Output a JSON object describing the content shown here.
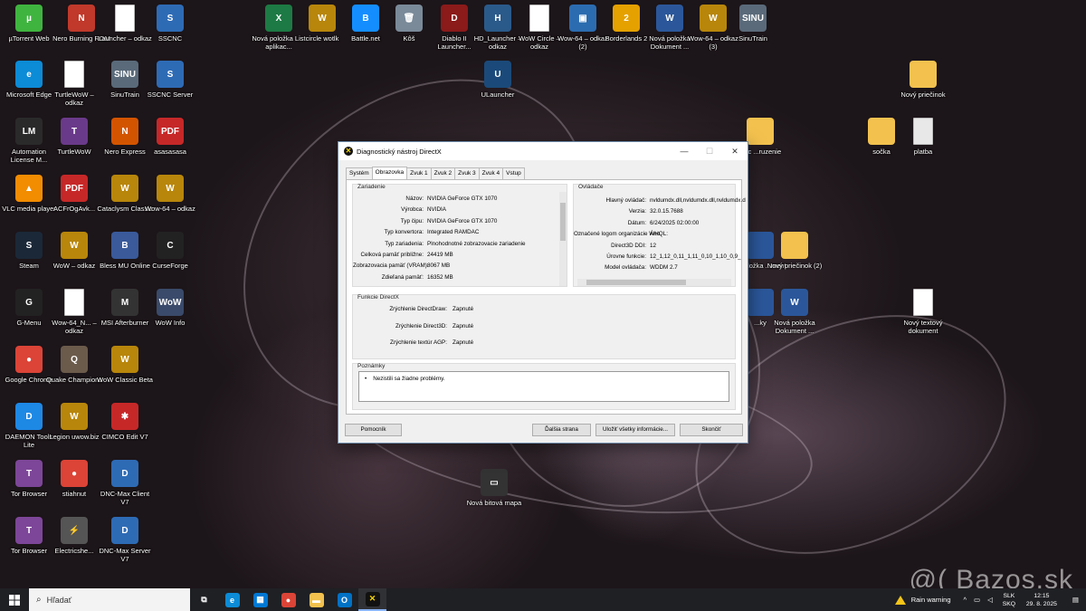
{
  "desktop": {
    "icons": [
      {
        "label": "µTorrent Web",
        "glyph": "µ",
        "color": "#3fb43f"
      },
      {
        "label": "Nero Burning ROM",
        "glyph": "N",
        "color": "#c0392b"
      },
      {
        "label": "Launcher – odkaz",
        "glyph": "",
        "color": "#ffffff"
      },
      {
        "label": "SSCNC",
        "glyph": "S",
        "color": "#2e6bb5"
      },
      {
        "label": "Nová položka List aplikac...",
        "glyph": "X",
        "color": "#1d7a44"
      },
      {
        "label": "circle wotlk",
        "glyph": "W",
        "color": "#b8860b"
      },
      {
        "label": "Battle.net",
        "glyph": "B",
        "color": "#148eff"
      },
      {
        "label": "Kôš",
        "glyph": "🗑",
        "color": "#7a8a99"
      },
      {
        "label": "Diablo II Launcher...",
        "glyph": "D",
        "color": "#8b1a1a"
      },
      {
        "label": "HD_Launcher – odkaz",
        "glyph": "H",
        "color": "#2a5a8a"
      },
      {
        "label": "WoW Circle – odkaz",
        "glyph": "",
        "color": "#ffffff"
      },
      {
        "label": "Wow-64 – odkaz (2)",
        "glyph": "▣",
        "color": "#2b6cb0"
      },
      {
        "label": "Borderlands 2",
        "glyph": "2",
        "color": "#e5a100"
      },
      {
        "label": "Nová položka Dokument ...",
        "glyph": "W",
        "color": "#2b579a"
      },
      {
        "label": "Wow-64 – odkaz (3)",
        "glyph": "W",
        "color": "#b8860b"
      },
      {
        "label": "SinuTrain",
        "glyph": "SINU",
        "color": "#5a6a7a"
      },
      {
        "label": "Microsoft Edge",
        "glyph": "e",
        "color": "#0c8bd6"
      },
      {
        "label": "TurtleWoW – odkaz",
        "glyph": "",
        "color": "#ffffff"
      },
      {
        "label": "SinuTrain",
        "glyph": "SINU",
        "color": "#5a6a7a"
      },
      {
        "label": "SSCNC Server",
        "glyph": "S",
        "color": "#2e6bb5"
      },
      {
        "label": "ULauncher",
        "glyph": "U",
        "color": "#1b4a7a"
      },
      {
        "label": "Nový priečinok",
        "glyph": "",
        "color": "#f2c14e"
      },
      {
        "label": "Automation License M...",
        "glyph": "LM",
        "color": "#2a2a2a"
      },
      {
        "label": "TurtleWoW",
        "glyph": "T",
        "color": "#6a3a8a"
      },
      {
        "label": "Nero Express",
        "glyph": "N",
        "color": "#d35400"
      },
      {
        "label": "asasasasa",
        "glyph": "PDF",
        "color": "#c62828"
      },
      {
        "label": "Dôc ...ruzenie",
        "glyph": "",
        "color": "#f2c14e"
      },
      {
        "label": "sočka",
        "glyph": "",
        "color": "#f2c14e"
      },
      {
        "label": "platba",
        "glyph": "",
        "color": "#e8e8e8"
      },
      {
        "label": "VLC media player",
        "glyph": "▲",
        "color": "#f28c00"
      },
      {
        "label": "ACFrOgAvk...",
        "glyph": "PDF",
        "color": "#c62828"
      },
      {
        "label": "Cataclysm Classic",
        "glyph": "W",
        "color": "#b8860b"
      },
      {
        "label": "Wow-64 – odkaz",
        "glyph": "W",
        "color": "#b8860b"
      },
      {
        "label": "Steam",
        "glyph": "S",
        "color": "#1b2838"
      },
      {
        "label": "WoW – odkaz",
        "glyph": "W",
        "color": "#b8860b"
      },
      {
        "label": "Bless MU Online",
        "glyph": "B",
        "color": "#3a5a9a"
      },
      {
        "label": "CurseForge",
        "glyph": "C",
        "color": "#222222"
      },
      {
        "label": "...položka ...ment",
        "glyph": "",
        "color": "#2b579a"
      },
      {
        "label": "Nový priečinok (2)",
        "glyph": "",
        "color": "#f2c14e"
      },
      {
        "label": "G-Menu",
        "glyph": "G",
        "color": "#222222"
      },
      {
        "label": "Wow-64_N... – odkaz",
        "glyph": "",
        "color": "#ffffff"
      },
      {
        "label": "MSI Afterburner",
        "glyph": "M",
        "color": "#333333"
      },
      {
        "label": "WoW Info",
        "glyph": "WoW",
        "color": "#3a4a6a"
      },
      {
        "label": "...ky",
        "glyph": "",
        "color": "#2b579a"
      },
      {
        "label": "Nová položka Dokument ...",
        "glyph": "W",
        "color": "#2b579a"
      },
      {
        "label": "Nový textový dokument",
        "glyph": "",
        "color": "#ffffff"
      },
      {
        "label": "Google Chrome",
        "glyph": "●",
        "color": "#db4437"
      },
      {
        "label": "Quake Champions",
        "glyph": "Q",
        "color": "#6b5b4b"
      },
      {
        "label": "WoW Classic Beta",
        "glyph": "W",
        "color": "#b8860b"
      },
      {
        "label": "DAEMON Tools Lite",
        "glyph": "D",
        "color": "#1e88e5"
      },
      {
        "label": "Legion uwow.biz",
        "glyph": "W",
        "color": "#b8860b"
      },
      {
        "label": "CIMCO Edit V7",
        "glyph": "✱",
        "color": "#c62828"
      },
      {
        "label": "Tor Browser",
        "glyph": "T",
        "color": "#7d4698"
      },
      {
        "label": "stiahnut",
        "glyph": "●",
        "color": "#db4437"
      },
      {
        "label": "DNC-Max Client V7",
        "glyph": "D",
        "color": "#2e6bb5"
      },
      {
        "label": "Nová bitová mapa",
        "glyph": "▭",
        "color": "#333333"
      },
      {
        "label": "Tor Browser",
        "glyph": "T",
        "color": "#7d4698"
      },
      {
        "label": "Electricshe...",
        "glyph": "⚡",
        "color": "#555555"
      },
      {
        "label": "DNC-Max Server V7",
        "glyph": "D",
        "color": "#2e6bb5"
      }
    ]
  },
  "dxdiag": {
    "title": "Diagnostický nástroj DirectX",
    "minimize": "—",
    "maximize": "☐",
    "close": "✕",
    "tabs": [
      "Systém",
      "Obrazovka",
      "Zvuk 1",
      "Zvuk 2",
      "Zvuk 3",
      "Zvuk 4",
      "Vstup"
    ],
    "device_title": "Zariadenie",
    "device": [
      {
        "k": "Názov:",
        "v": "NVIDIA GeForce GTX 1070"
      },
      {
        "k": "Výrobca:",
        "v": "NVIDIA"
      },
      {
        "k": "Typ čipu:",
        "v": "NVIDIA GeForce GTX 1070"
      },
      {
        "k": "Typ konvertora:",
        "v": "Integrated RAMDAC"
      },
      {
        "k": "Typ zariadenia:",
        "v": "Plnohodnotné zobrazovacie zariadenie"
      },
      {
        "k": "Celková pamäť približne:",
        "v": "24419 MB"
      },
      {
        "k": "Zobrazovacia pamäť (VRAM):",
        "v": "8067 MB"
      },
      {
        "k": "Zdieľaná pamäť:",
        "v": "16352 MB"
      }
    ],
    "drivers_title": "Ovládače",
    "drivers": [
      {
        "k": "Hlavný ovládač:",
        "v": "nvldumdx.dll,nvldumdx.dll,nvldumdx.d"
      },
      {
        "k": "Verzia:",
        "v": "32.0.15.7688"
      },
      {
        "k": "Dátum:",
        "v": "6/24/2025 02:00:00"
      },
      {
        "k": "Označené logom organizácie WHQL:",
        "v": "Áno"
      },
      {
        "k": "Direct3D DDI:",
        "v": "12"
      },
      {
        "k": "Úrovne funkcie:",
        "v": "12_1,12_0,11_1,11_0,10_1,10_0,9_"
      },
      {
        "k": "Model ovládača:",
        "v": "WDDM 2.7"
      }
    ],
    "features_title": "Funkcie DirectX",
    "features": [
      {
        "k": "Zrýchlenie DirectDraw:",
        "v": "Zapnuté"
      },
      {
        "k": "Zrýchlenie Direct3D:",
        "v": "Zapnuté"
      },
      {
        "k": "Zrýchlenie textúr AGP:",
        "v": "Zapnuté"
      }
    ],
    "notes_title": "Poznámky",
    "notes": [
      "Nezistili sa žiadne problémy."
    ],
    "buttons": {
      "help": "Pomocník",
      "next": "Ďalšia strana",
      "save": "Uložiť všetky informácie...",
      "exit": "Skončiť"
    }
  },
  "taskbar": {
    "search_placeholder": "Hľadať",
    "pinned": [
      {
        "name": "task-view",
        "glyph": "⧉",
        "color": "#1f2024"
      },
      {
        "name": "edge",
        "glyph": "e",
        "color": "#0c8bd6"
      },
      {
        "name": "store",
        "glyph": "▦",
        "color": "#0078d4"
      },
      {
        "name": "chrome",
        "glyph": "●",
        "color": "#db4437"
      },
      {
        "name": "explorer",
        "glyph": "▬",
        "color": "#f2c14e"
      },
      {
        "name": "outlook",
        "glyph": "O",
        "color": "#0072c6"
      },
      {
        "name": "directx",
        "glyph": "✕",
        "color": "#111111"
      }
    ],
    "weather": "Rain warning",
    "lang_top": "SLK",
    "lang_bottom": "SKQ",
    "time": "12:15",
    "date": "29. 8. 2025"
  },
  "watermark": "@( Bazos.sk"
}
